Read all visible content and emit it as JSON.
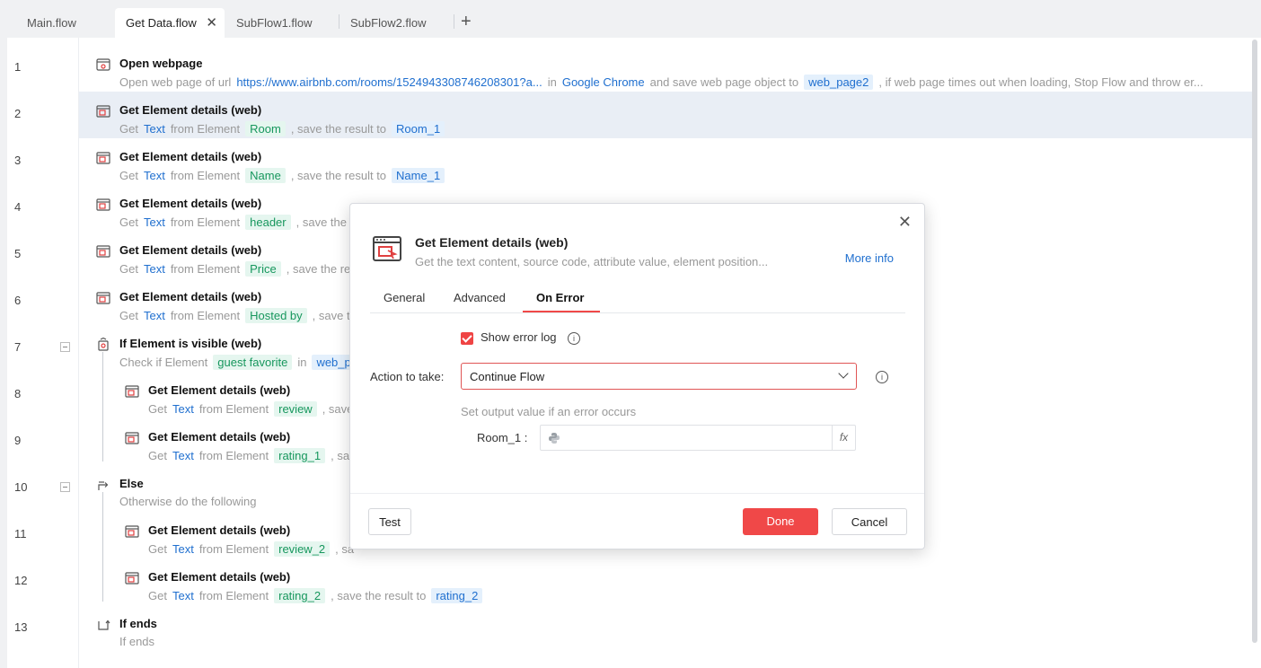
{
  "tabs": [
    {
      "label": "Main.flow"
    },
    {
      "label": "Get Data.flow",
      "active": true,
      "close": "✕"
    },
    {
      "label": "SubFlow1.flow"
    },
    {
      "label": "SubFlow2.flow"
    }
  ],
  "add_tab": "+",
  "rows": [
    {
      "num": "1",
      "title": "Open webpage",
      "icon": "browser-icon",
      "desc": {
        "t1": "Open web page of url",
        "url": "https://www.airbnb.com/rooms/1524943308746208301?a...",
        "t2": "in",
        "browser": "Google Chrome",
        "t3": "and save web page object to",
        "var": "web_page2",
        "t4": ", if web page times out when loading, Stop Flow and throw er..."
      }
    },
    {
      "num": "2",
      "title": "Get Element details (web)",
      "icon": "element-details-icon",
      "desc": {
        "get": "Get",
        "kw": "Text",
        "from": "from Element",
        "el": "Room",
        "save": ", save the result to",
        "out": "Room_1"
      }
    },
    {
      "num": "3",
      "title": "Get Element details (web)",
      "icon": "element-details-icon",
      "desc": {
        "get": "Get",
        "kw": "Text",
        "from": "from Element",
        "el": "Name",
        "save": ", save the result to",
        "out": "Name_1"
      }
    },
    {
      "num": "4",
      "title": "Get Element details (web)",
      "icon": "element-details-icon",
      "desc": {
        "get": "Get",
        "kw": "Text",
        "from": "from Element",
        "el": "header",
        "save": ", save the"
      }
    },
    {
      "num": "5",
      "title": "Get Element details (web)",
      "icon": "element-details-icon",
      "desc": {
        "get": "Get",
        "kw": "Text",
        "from": "from Element",
        "el": "Price",
        "save": ", save the re"
      }
    },
    {
      "num": "6",
      "title": "Get Element details (web)",
      "icon": "element-details-icon",
      "desc": {
        "get": "Get",
        "kw": "Text",
        "from": "from Element",
        "el": "Hosted by",
        "save": ", save t"
      }
    },
    {
      "num": "7",
      "title": "If Element is visible (web)",
      "icon": "if-visible-icon",
      "desc": {
        "t1": "Check if Element",
        "el": "guest favorite",
        "in": "in",
        "var": "web_p"
      }
    },
    {
      "num": "8",
      "title": "Get Element details (web)",
      "icon": "element-details-icon",
      "desc": {
        "get": "Get",
        "kw": "Text",
        "from": "from Element",
        "el": "review",
        "save": ", save"
      }
    },
    {
      "num": "9",
      "title": "Get Element details (web)",
      "icon": "element-details-icon",
      "desc": {
        "get": "Get",
        "kw": "Text",
        "from": "from Element",
        "el": "rating_1",
        "save": ", sa"
      }
    },
    {
      "num": "10",
      "title": "Else",
      "icon": "else-icon",
      "desc": {
        "t1": "Otherwise do the following"
      }
    },
    {
      "num": "11",
      "title": "Get Element details (web)",
      "icon": "element-details-icon",
      "desc": {
        "get": "Get",
        "kw": "Text",
        "from": "from Element",
        "el": "review_2",
        "save": ", sa"
      }
    },
    {
      "num": "12",
      "title": "Get Element details (web)",
      "icon": "element-details-icon",
      "desc": {
        "get": "Get",
        "kw": "Text",
        "from": "from Element",
        "el": "rating_2",
        "save": ", save the result to",
        "out": "rating_2"
      }
    },
    {
      "num": "13",
      "title": "If ends",
      "icon": "if-ends-icon",
      "desc": {
        "t1": "If ends"
      }
    }
  ],
  "dialog": {
    "title": "Get Element details (web)",
    "subtitle": "Get the text content, source code, attribute value, element position...",
    "more_info": "More info",
    "close": "✕",
    "tabs": [
      "General",
      "Advanced",
      "On Error"
    ],
    "show_error_log": "Show error log",
    "show_error_log_checked": true,
    "action_label": "Action to take:",
    "action_value": "Continue Flow",
    "output_hint": "Set output value if an error occurs",
    "output_var": "Room_1 :",
    "output_value": "",
    "fx": "fx",
    "info": "i",
    "test": "Test",
    "done": "Done",
    "cancel": "Cancel"
  },
  "colors": {
    "accent_red": "#f04848",
    "keyword_blue": "#1f6fcf",
    "element_green": "#17975d",
    "selected_row": "#e9eef5"
  }
}
